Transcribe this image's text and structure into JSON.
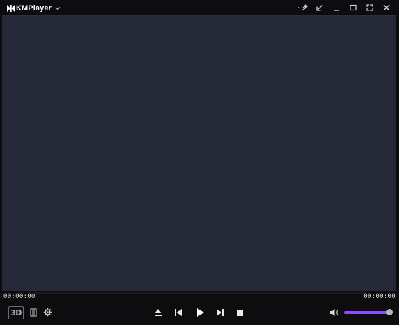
{
  "app": {
    "name": "KMPlayer"
  },
  "title_bar": {
    "buttons": [
      "pin-icon",
      "mini-mode-icon",
      "minimize-icon",
      "maximize-icon",
      "fullscreen-icon",
      "close-icon"
    ]
  },
  "playback": {
    "current_time": "00:00:00",
    "total_time": "00:00:00",
    "progress": 0
  },
  "controls": {
    "mode_3d_label": "3D",
    "buttons_left": [
      "playlist-icon",
      "settings-icon"
    ],
    "transport": [
      "eject-icon",
      "previous-icon",
      "play-icon",
      "next-icon",
      "stop-icon"
    ],
    "volume_level": 1.0,
    "volume_color": "#8a4dff"
  },
  "colors": {
    "video_bg": "#252836",
    "chrome_bg": "#0d0d10"
  }
}
